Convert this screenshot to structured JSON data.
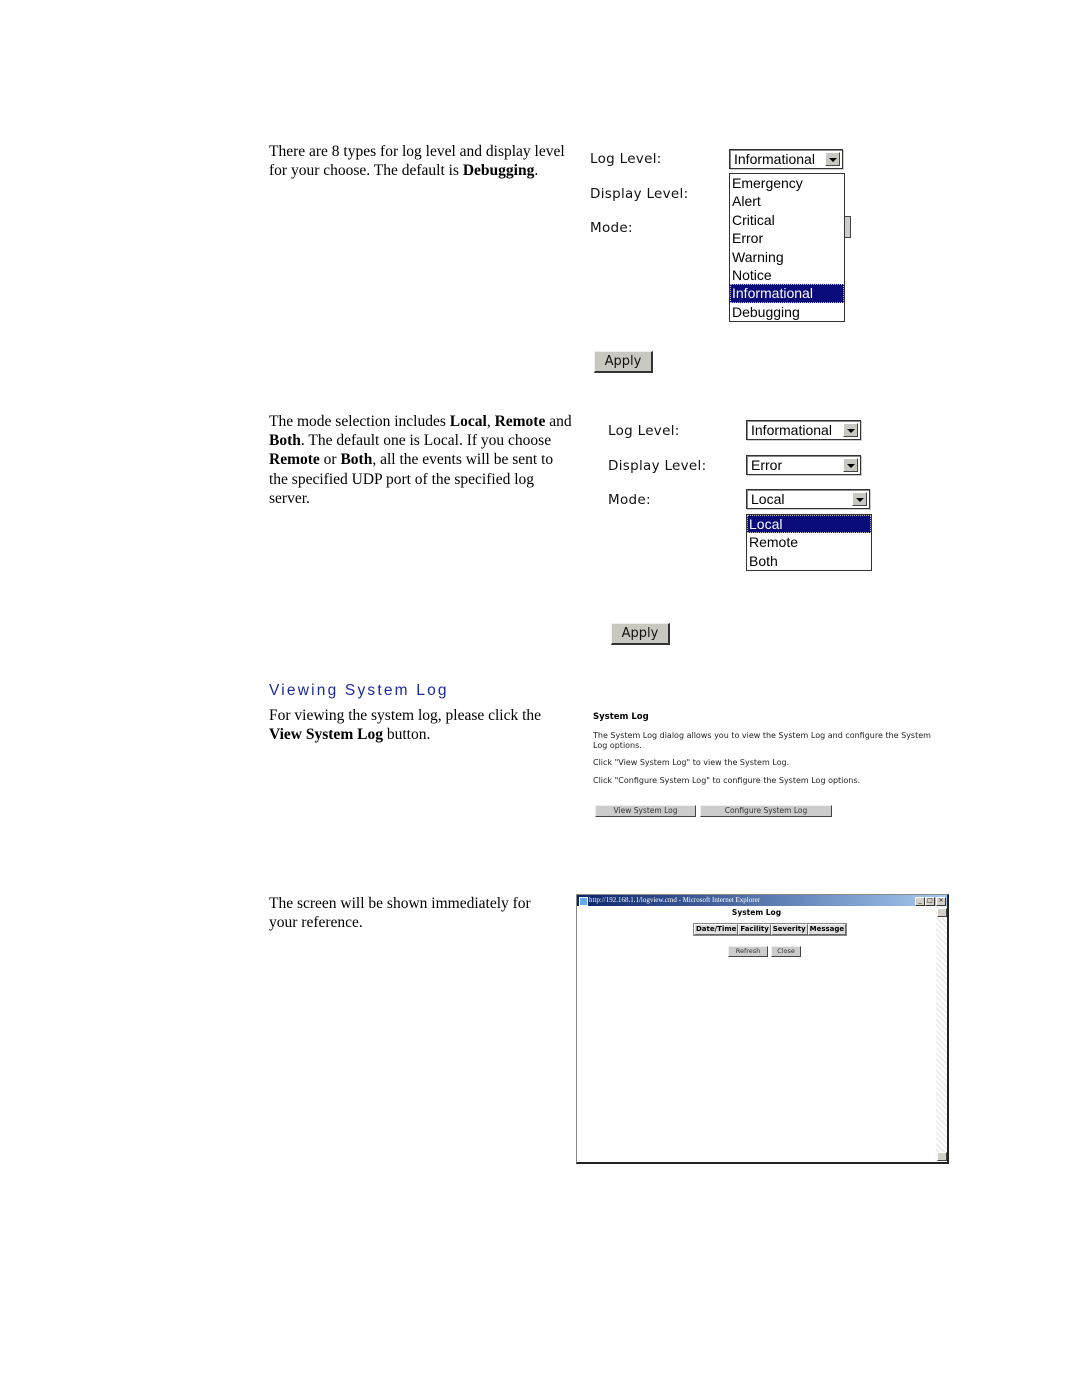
{
  "section1": {
    "para_parts": [
      "There are 8 types for log level and display level for your choose. The default is ",
      "Debugging",
      "."
    ],
    "form": {
      "log_level_label": "Log Level:",
      "display_level_label": "Display Level:",
      "mode_label": "Mode:",
      "log_level_value": "Informational",
      "dropdown_options": [
        "Emergency",
        "Alert",
        "Critical",
        "Error",
        "Warning",
        "Notice",
        "Informational",
        "Debugging"
      ],
      "dropdown_selected": "Informational",
      "apply_label": "Apply"
    }
  },
  "section2": {
    "para_parts": [
      "The mode selection includes ",
      "Local",
      ", ",
      "Remote",
      " and ",
      "Both",
      ". The default one is Local. If you choose ",
      "Remote",
      " or ",
      "Both",
      ", all the events will be sent to the specified UDP port of the specified log server."
    ],
    "form": {
      "log_level_label": "Log Level:",
      "display_level_label": "Display Level:",
      "mode_label": "Mode:",
      "log_level_value": "Informational",
      "display_level_value": "Error",
      "mode_value": "Local",
      "mode_options": [
        "Local",
        "Remote",
        "Both"
      ],
      "mode_selected": "Local",
      "apply_label": "Apply"
    }
  },
  "section3": {
    "heading": "Viewing System Log",
    "para_parts": [
      "For viewing the system log, please click the ",
      "View System Log",
      " button."
    ],
    "panel": {
      "title": "System Log",
      "description": "The System Log dialog allows you to view the System Log and configure the System Log options.",
      "hint_view": "Click \"View System Log\" to view the System Log.",
      "hint_configure": "Click \"Configure System Log\" to configure the System Log options.",
      "view_button": "View System Log",
      "configure_button": "Configure System Log"
    }
  },
  "section4": {
    "para": "The screen will be shown immediately for your reference.",
    "window": {
      "title_bar": "http://192.168.1.1/logview.cmd - Microsoft Internet Explorer",
      "minimize": "_",
      "maximize": "□",
      "close": "×",
      "page_title": "System Log",
      "columns": [
        "Date/Time",
        "Facility",
        "Severity",
        "Message"
      ],
      "refresh_button": "Refresh",
      "close_button": "Close"
    }
  }
}
